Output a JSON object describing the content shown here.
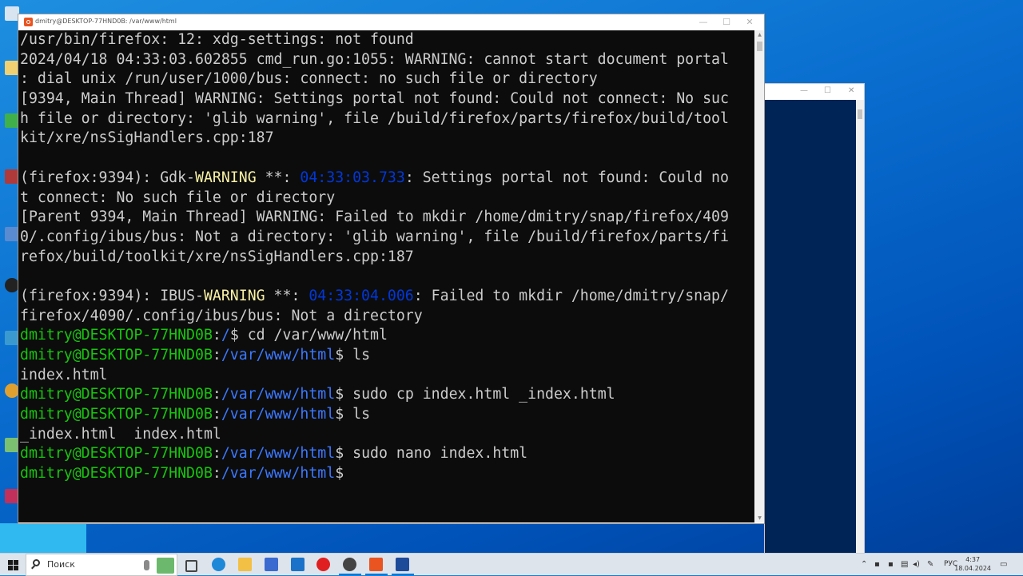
{
  "terminal": {
    "window_title": "dmitry@DESKTOP-77HND0B: /var/www/html",
    "lines": [
      [
        {
          "t": "/usr/bin/firefox: 12: xdg-settings: not found",
          "c": ""
        }
      ],
      [
        {
          "t": "2024/04/18 04:33:03.602855 cmd_run.go:1055: WARNING: cannot start document portal",
          "c": ""
        }
      ],
      [
        {
          "t": ": dial unix /run/user/1000/bus: connect: no such file or directory",
          "c": ""
        }
      ],
      [
        {
          "t": "[9394, Main Thread] WARNING: Settings portal not found: Could not connect: No suc",
          "c": ""
        }
      ],
      [
        {
          "t": "h file or directory: 'glib warning', file /build/firefox/parts/firefox/build/tool",
          "c": ""
        }
      ],
      [
        {
          "t": "kit/xre/nsSigHandlers.cpp:187",
          "c": ""
        }
      ],
      [
        {
          "t": "",
          "c": ""
        }
      ],
      [
        {
          "t": "(firefox:9394): Gdk-",
          "c": ""
        },
        {
          "t": "WARNING",
          "c": "c-yellow"
        },
        {
          "t": " **: ",
          "c": ""
        },
        {
          "t": "04:33:03.733",
          "c": "c-dblue"
        },
        {
          "t": ": Settings portal not found: Could no",
          "c": ""
        }
      ],
      [
        {
          "t": "t connect: No such file or directory",
          "c": ""
        }
      ],
      [
        {
          "t": "[Parent 9394, Main Thread] WARNING: Failed to mkdir /home/dmitry/snap/firefox/409",
          "c": ""
        }
      ],
      [
        {
          "t": "0/.config/ibus/bus: Not a directory: 'glib warning', file /build/firefox/parts/fi",
          "c": ""
        }
      ],
      [
        {
          "t": "refox/build/toolkit/xre/nsSigHandlers.cpp:187",
          "c": ""
        }
      ],
      [
        {
          "t": "",
          "c": ""
        }
      ],
      [
        {
          "t": "(firefox:9394): IBUS-",
          "c": ""
        },
        {
          "t": "WARNING",
          "c": "c-yellow"
        },
        {
          "t": " **: ",
          "c": ""
        },
        {
          "t": "04:33:04.006",
          "c": "c-dblue"
        },
        {
          "t": ": Failed to mkdir /home/dmitry/snap/",
          "c": ""
        }
      ],
      [
        {
          "t": "firefox/4090/.config/ibus/bus: Not a directory",
          "c": ""
        }
      ],
      [
        {
          "t": "dmitry@DESKTOP-77HND0B",
          "c": "c-green"
        },
        {
          "t": ":",
          "c": ""
        },
        {
          "t": "/",
          "c": "c-blue"
        },
        {
          "t": "$ cd /var/www/html",
          "c": ""
        }
      ],
      [
        {
          "t": "dmitry@DESKTOP-77HND0B",
          "c": "c-green"
        },
        {
          "t": ":",
          "c": ""
        },
        {
          "t": "/var/www/html",
          "c": "c-blue"
        },
        {
          "t": "$ ls",
          "c": ""
        }
      ],
      [
        {
          "t": "index.html",
          "c": ""
        }
      ],
      [
        {
          "t": "dmitry@DESKTOP-77HND0B",
          "c": "c-green"
        },
        {
          "t": ":",
          "c": ""
        },
        {
          "t": "/var/www/html",
          "c": "c-blue"
        },
        {
          "t": "$ sudo cp index.html _index.html",
          "c": ""
        }
      ],
      [
        {
          "t": "dmitry@DESKTOP-77HND0B",
          "c": "c-green"
        },
        {
          "t": ":",
          "c": ""
        },
        {
          "t": "/var/www/html",
          "c": "c-blue"
        },
        {
          "t": "$ ls",
          "c": ""
        }
      ],
      [
        {
          "t": "_index.html  index.html",
          "c": ""
        }
      ],
      [
        {
          "t": "dmitry@DESKTOP-77HND0B",
          "c": "c-green"
        },
        {
          "t": ":",
          "c": ""
        },
        {
          "t": "/var/www/html",
          "c": "c-blue"
        },
        {
          "t": "$ sudo nano index.html",
          "c": ""
        }
      ],
      [
        {
          "t": "dmitry@DESKTOP-77HND0B",
          "c": "c-green"
        },
        {
          "t": ":",
          "c": ""
        },
        {
          "t": "/var/www/html",
          "c": "c-blue"
        },
        {
          "t": "$",
          "c": ""
        }
      ]
    ]
  },
  "taskbar": {
    "search_placeholder": "Поиск",
    "language": "РУС",
    "time": "4:37",
    "date": "18.04.2024"
  },
  "colors": {
    "prompt_user": "#16c60c",
    "prompt_path": "#3b78ff",
    "warning": "#f9f1a5",
    "timestamp": "#0037da",
    "terminal_bg": "#0c0c0c"
  }
}
